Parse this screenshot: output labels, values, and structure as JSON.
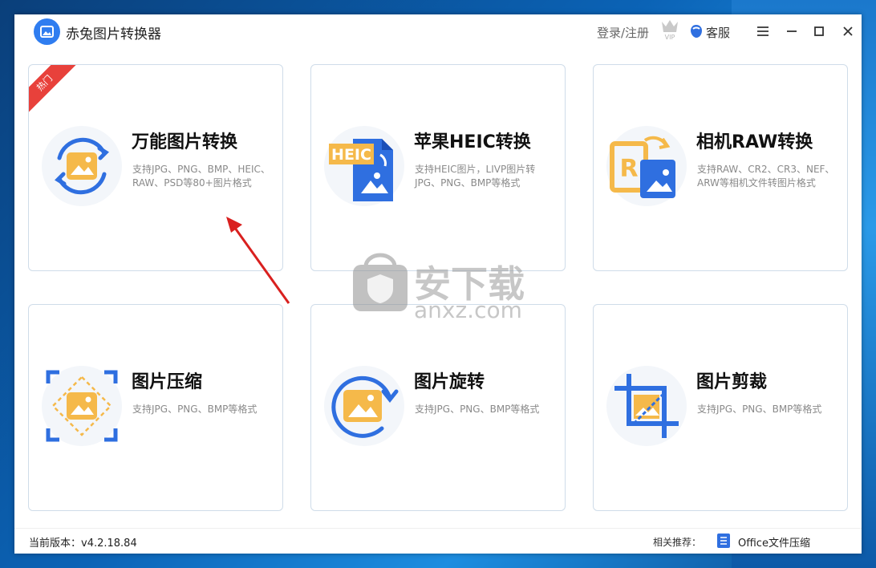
{
  "window": {
    "title": "赤兔图片转换器"
  },
  "header": {
    "login_label": "登录/注册",
    "vip_badge": "VIP",
    "service_label": "客服"
  },
  "cards": [
    {
      "title": "万能图片转换",
      "desc": "支持JPG、PNG、BMP、HEIC、RAW、PSD等80+图片格式",
      "badge": "热门"
    },
    {
      "title": "苹果HEIC转换",
      "desc": "支持HEIC图片，LIVP图片转JPG、PNG、BMP等格式",
      "icon_text": "HEIC"
    },
    {
      "title": "相机RAW转换",
      "desc": "支持RAW、CR2、CR3、NEF、ARW等相机文件转图片格式",
      "icon_text": "R"
    },
    {
      "title": "图片压缩",
      "desc": "支持JPG、PNG、BMP等格式"
    },
    {
      "title": "图片旋转",
      "desc": "支持JPG、PNG、BMP等格式"
    },
    {
      "title": "图片剪裁",
      "desc": "支持JPG、PNG、BMP等格式"
    }
  ],
  "footer": {
    "version": "当前版本：v4.2.18.84",
    "related_label": "相关推荐：",
    "related_app": "Office文件压缩"
  },
  "watermark": {
    "text": "安下载",
    "sub": "anxz.com"
  },
  "colors": {
    "accent": "#2f6fe0",
    "image_yellow": "#f5b94a",
    "hot_red": "#e8413b",
    "arrow_red": "#d9201f"
  }
}
